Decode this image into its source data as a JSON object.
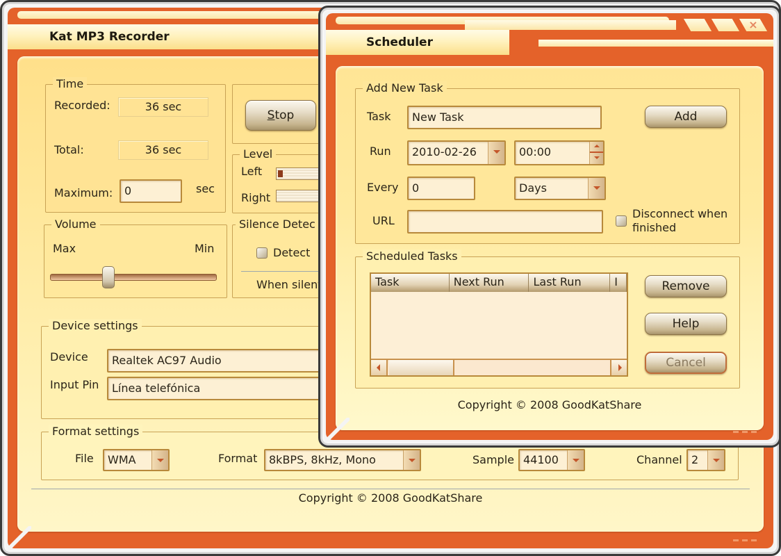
{
  "main_window": {
    "title": "Kat MP3 Recorder",
    "time_group": {
      "legend": "Time",
      "recorded_label": "Recorded:",
      "recorded_value": "36 sec",
      "total_label": "Total:",
      "total_value": "36 sec",
      "maximum_label": "Maximum:",
      "maximum_value": "0",
      "maximum_unit": "sec"
    },
    "stop_button": {
      "label_prefix": "",
      "label_mnemonic": "S",
      "label_rest": "top"
    },
    "level_group": {
      "legend": "Level",
      "left_label": "Left",
      "right_label": "Right",
      "left_level_percent": 8,
      "right_level_percent": 0
    },
    "volume_group": {
      "legend": "Volume",
      "max_label": "Max",
      "min_label": "Min",
      "slider_position_percent": 34
    },
    "silence_group": {
      "legend": "Silence Detec",
      "detect_label": "Detect",
      "detect_checked": false,
      "when_silent_label": "When silent"
    },
    "device_group": {
      "legend": "Device settings",
      "device_label": "Device",
      "device_value": "Realtek AC97 Audio",
      "input_pin_label": "Input Pin",
      "input_pin_value": "Línea telefónica"
    },
    "format_group": {
      "legend": "Format settings",
      "file_label": "File",
      "file_value": "WMA",
      "format_label": "Format",
      "format_value": "8kBPS, 8kHz, Mono",
      "sample_label": "Sample",
      "sample_value": "44100",
      "channel_label": "Channel",
      "channel_value": "2"
    },
    "copyright": "Copyright © 2008 GoodKatShare"
  },
  "scheduler": {
    "title": "Scheduler",
    "close_glyph": "×",
    "add_group": {
      "legend": "Add New Task",
      "task_label": "Task",
      "task_value": "New Task",
      "add_button": "Add",
      "run_label": "Run",
      "run_date": "2010-02-26",
      "run_time": "00:00",
      "every_label": "Every",
      "every_value": "0",
      "every_unit": "Days",
      "url_label": "URL",
      "url_value": "",
      "disconnect_label_line1": "Disconnect when",
      "disconnect_label_line2": "finished",
      "disconnect_checked": false
    },
    "tasks_group": {
      "legend": "Scheduled Tasks",
      "columns": [
        "Task",
        "Next Run",
        "Last Run",
        "I"
      ],
      "rows": [],
      "remove_button": "Remove",
      "help_button": "Help",
      "cancel_button": "Cancel"
    },
    "copyright": "Copyright © 2008 GoodKatShare"
  },
  "colors": {
    "frame_orange": "#e4622a",
    "client_yellow": "#ffe898",
    "input_bg": "#fdf0d4"
  }
}
